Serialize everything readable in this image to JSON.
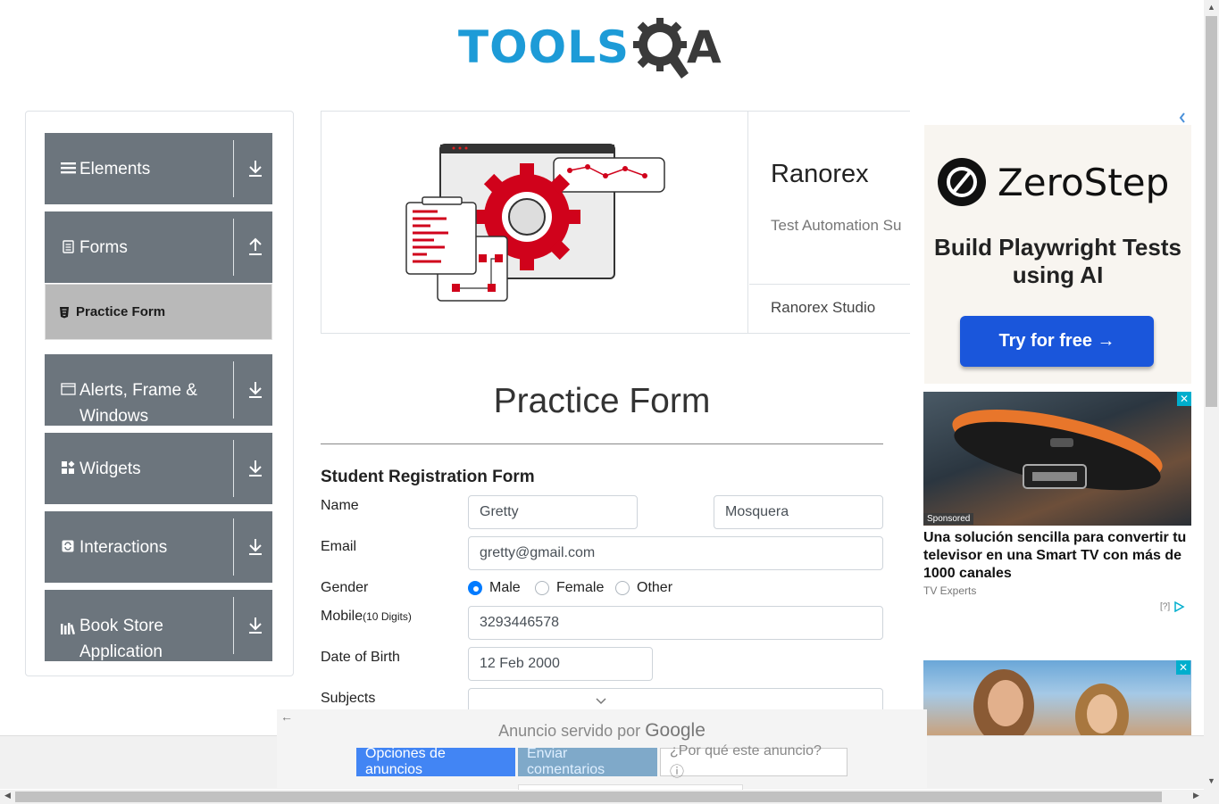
{
  "header": {
    "logo_tools": "TOOLS",
    "logo_a": "A"
  },
  "sidebar": {
    "groups": [
      {
        "label": "Elements",
        "icon": "menu-icon",
        "arrow": "down"
      },
      {
        "label": "Forms",
        "icon": "document-icon",
        "arrow": "up"
      },
      {
        "label": "Alerts, Frame & Windows",
        "icon": "window-icon",
        "arrow": "down"
      },
      {
        "label": "Widgets",
        "icon": "widgets-icon",
        "arrow": "down"
      },
      {
        "label": "Interactions",
        "icon": "refresh-icon",
        "arrow": "down"
      },
      {
        "label": "Book Store Application",
        "icon": "books-icon",
        "arrow": "down"
      }
    ],
    "active_item": {
      "label": "Practice Form",
      "icon": "html5-icon"
    }
  },
  "banner": {
    "title": "Ranorex",
    "subtitle": "Test Automation Su",
    "footer": "Ranorex Studio"
  },
  "form": {
    "page_title": "Practice Form",
    "heading": "Student Registration Form",
    "name_label": "Name",
    "first_name": "Gretty",
    "last_name": "Mosquera",
    "email_label": "Email",
    "email": "gretty@gmail.com",
    "gender_label": "Gender",
    "gender_options": [
      "Male",
      "Female",
      "Other"
    ],
    "gender_selected": "Male",
    "mobile_label": "Mobile",
    "mobile_hint": "(10 Digits)",
    "mobile": "3293446578",
    "dob_label": "Date of Birth",
    "dob": "12 Feb 2000",
    "subjects_label": "Subjects",
    "subjects": ""
  },
  "ads": {
    "zerostep": {
      "name": "ZeroStep",
      "tagline": "Build Playwright Tests using AI",
      "cta": "Try for free →"
    },
    "tv": {
      "sponsored": "Sponsored",
      "title": "Una solución sencilla para convertir tu televisor en una Smart TV con más de 1000 canales",
      "source": "TV Experts",
      "help": "[?]"
    },
    "close_glyph": "✕",
    "bottom": {
      "served_by": "Anuncio servido por",
      "google": "Google",
      "btn_options": "Opciones de anuncios",
      "btn_feedback": "Enviar comentarios",
      "btn_why": "¿Por qué este anuncio? ⓘ",
      "back_arrow": "←"
    }
  },
  "colors": {
    "brand_blue": "#1d9bd7",
    "sidebar_gray": "#6c757d",
    "active_gray": "#b9b9b9",
    "radio_blue": "#007bff",
    "ad_blue": "#4285f4"
  }
}
